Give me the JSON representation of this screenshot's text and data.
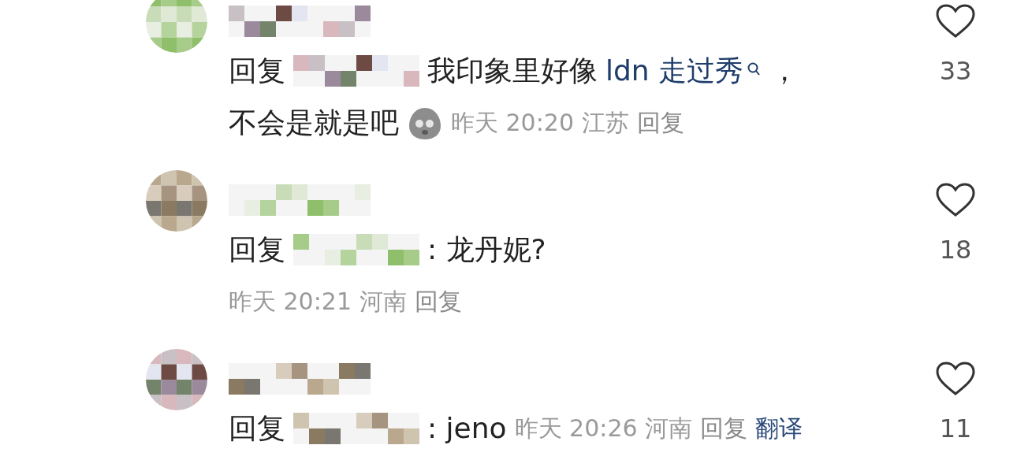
{
  "comments": [
    {
      "body": [
        {
          "kind": "reply_prefix",
          "text": "回复"
        },
        {
          "kind": "hidden_name"
        },
        {
          "kind": "text",
          "text": "我印象里好像"
        },
        {
          "kind": "link",
          "text": "ldn 走过秀"
        },
        {
          "kind": "text",
          "text": "，"
        },
        {
          "kind": "text",
          "text": "不会是就是吧"
        },
        {
          "kind": "emoji"
        }
      ],
      "time": "昨天 20:20",
      "location": "江苏",
      "reply": "回复",
      "likes": "33",
      "liked": false
    },
    {
      "body": [
        {
          "kind": "reply_prefix",
          "text": "回复"
        },
        {
          "kind": "hidden_name"
        },
        {
          "kind": "text",
          "text": ": 龙丹妮?"
        }
      ],
      "time": "昨天 20:21",
      "location": "河南",
      "reply": "回复",
      "meta_on_new_line": true,
      "likes": "18",
      "liked": false
    },
    {
      "body": [
        {
          "kind": "reply_prefix",
          "text": "回复"
        },
        {
          "kind": "hidden_name"
        },
        {
          "kind": "text",
          "text": ": jeno"
        }
      ],
      "time": "昨天 20:26",
      "location": "河南",
      "reply": "回复",
      "translate": "翻译",
      "likes": "11",
      "liked": false
    }
  ]
}
